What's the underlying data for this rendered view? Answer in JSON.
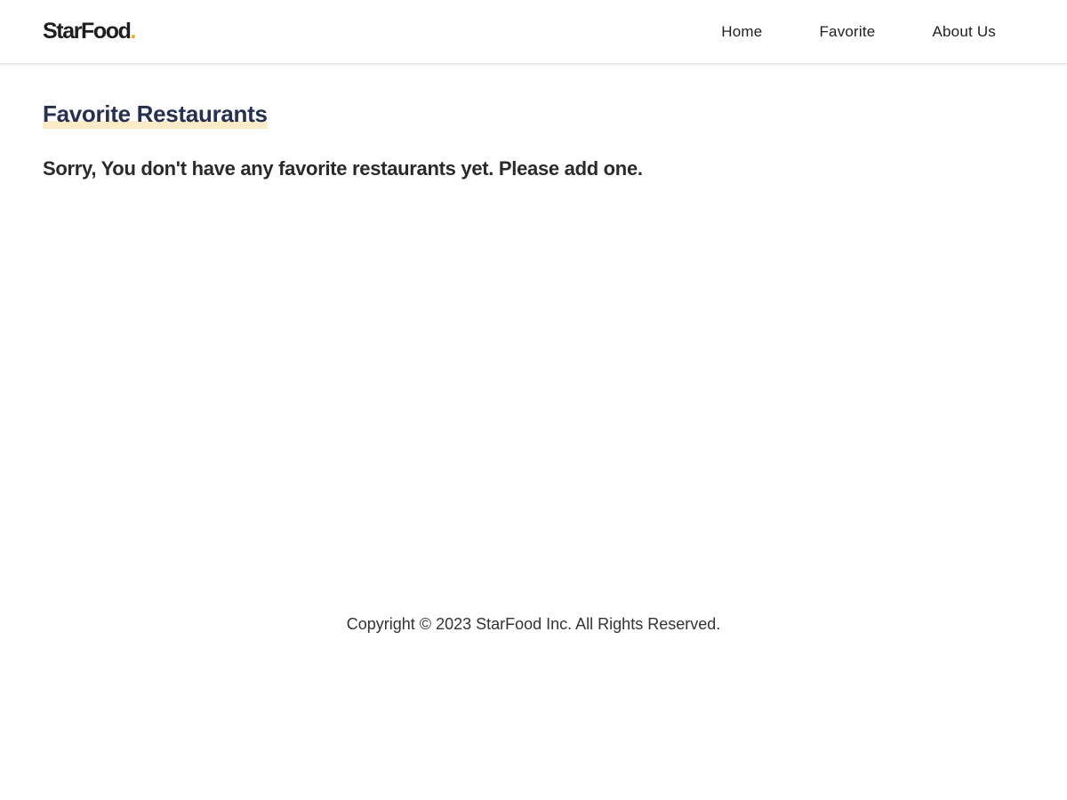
{
  "header": {
    "brand_text": "StarFood",
    "brand_dot": ".",
    "nav": [
      {
        "label": "Home"
      },
      {
        "label": "Favorite"
      },
      {
        "label": "About Us"
      }
    ]
  },
  "main": {
    "title": "Favorite Restaurants",
    "empty_message": "Sorry, You don't have any favorite restaurants yet. Please add one."
  },
  "footer": {
    "copyright": "Copyright © 2023 StarFood Inc. All Rights Reserved."
  },
  "colors": {
    "brand_accent": "#f5a623",
    "title": "#27304f",
    "title_highlight": "#fbecc7"
  }
}
